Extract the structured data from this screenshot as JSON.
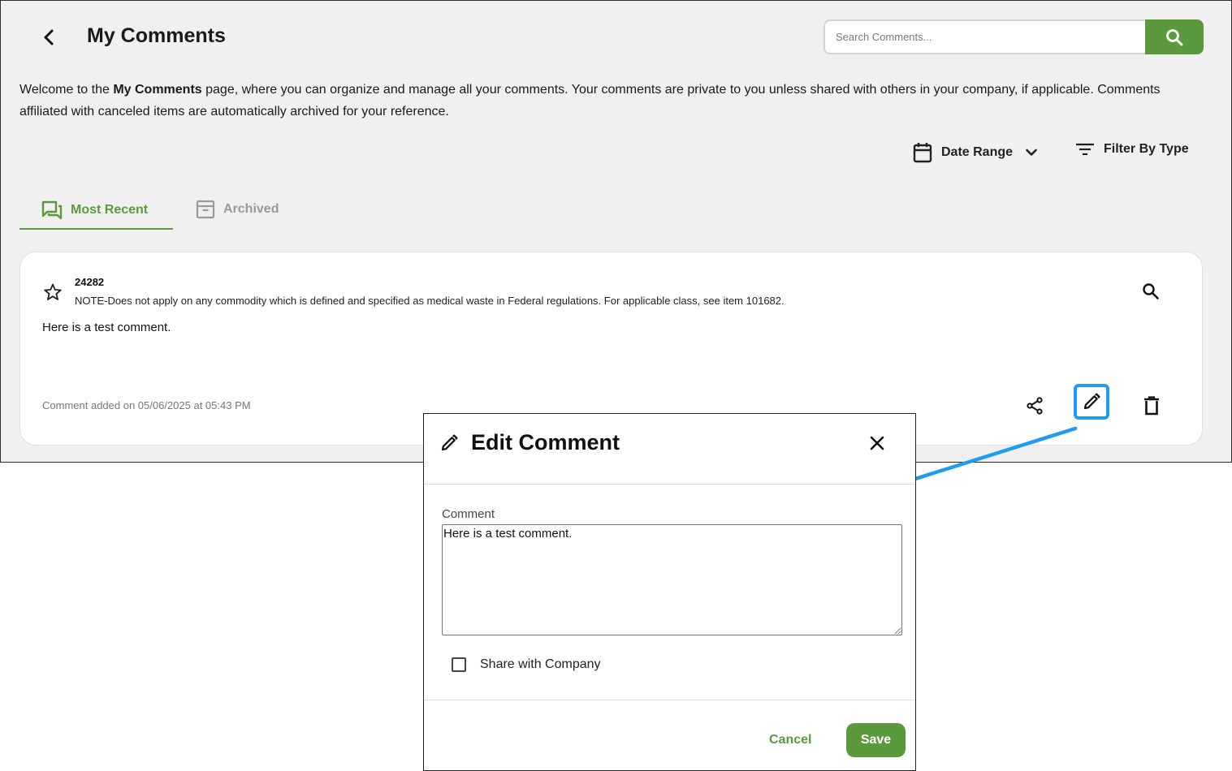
{
  "header": {
    "title": "My Comments",
    "search_placeholder": "Search Comments..."
  },
  "intro": {
    "prefix": "Welcome to the ",
    "bold": "My Comments",
    "suffix": " page, where you can organize and manage all your comments. Your comments are private to you unless shared with others in your company, if applicable. Comments affiliated with canceled items are automatically archived for your reference."
  },
  "filters": {
    "date_range": "Date Range",
    "filter_by_type": "Filter By Type"
  },
  "tabs": [
    {
      "label": "Most Recent",
      "active": true
    },
    {
      "label": "Archived",
      "active": false
    }
  ],
  "comment_card": {
    "item_number": "24282",
    "item_note": "NOTE-Does not apply on any commodity which is defined and specified as medical waste in Federal regulations. For applicable class, see item 101682.",
    "comment": "Here is a test comment.",
    "timestamp": "Comment added on 05/06/2025 at 05:43 PM"
  },
  "dialog": {
    "title": "Edit Comment",
    "field_label": "Comment",
    "field_value": "Here is a test comment.",
    "share_label": "Share with Company",
    "share_checked": false,
    "cancel_label": "Cancel",
    "save_label": "Save"
  },
  "colors": {
    "brand_green": "#5b9a3c",
    "highlight_blue": "#1f9cf0",
    "page_bg": "#f0f0f0"
  }
}
